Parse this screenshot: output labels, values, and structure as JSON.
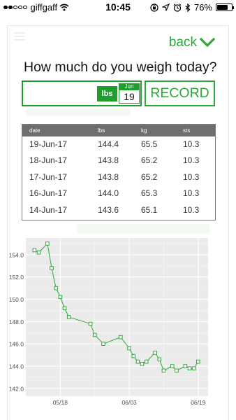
{
  "status_bar": {
    "carrier": "giffgaff",
    "time": "10:45",
    "battery": "76%",
    "battery_level": 0.76
  },
  "header": {
    "back_label": "back"
  },
  "form": {
    "question": "How much do you weigh today?",
    "weight_value": "",
    "unit_label": "lbs",
    "date_month": "Jun",
    "date_day": "19",
    "record_label": "RECORD"
  },
  "table": {
    "headers": [
      "date",
      "lbs",
      "kg",
      "sts"
    ],
    "rows": [
      [
        "19-Jun-17",
        "144.4",
        "65.5",
        "10.3"
      ],
      [
        "18-Jun-17",
        "143.8",
        "65.2",
        "10.3"
      ],
      [
        "17-Jun-17",
        "143.8",
        "65.2",
        "10.3"
      ],
      [
        "16-Jun-17",
        "144.0",
        "65.3",
        "10.3"
      ],
      [
        "14-Jun-17",
        "143.6",
        "65.1",
        "10.3"
      ]
    ]
  },
  "colors": {
    "accent": "#2ea73a",
    "accent_dark": "#1e9e2c",
    "table_header": "#6e6e6e",
    "chart_bg": "#ebebeb"
  },
  "chart_data": {
    "type": "line",
    "title": "",
    "xlabel": "",
    "ylabel": "",
    "ylim": [
      141.3,
      155.5
    ],
    "y_ticks": [
      "142.0",
      "144.0",
      "146.0",
      "148.0",
      "150.0",
      "152.0",
      "154.0"
    ],
    "x_ticks": [
      "05/18",
      "06/03",
      "06/19"
    ],
    "grid": true,
    "series": [
      {
        "dates": [
          "05/12",
          "05/13",
          "05/15",
          "05/16",
          "05/17",
          "05/18",
          "05/19",
          "05/20",
          "05/25",
          "05/26",
          "05/28",
          "06/01",
          "06/03",
          "06/04",
          "06/05",
          "06/06",
          "06/07",
          "06/09",
          "06/10",
          "06/11",
          "06/13",
          "06/14",
          "06/16",
          "06/17",
          "06/18",
          "06/19"
        ],
        "values": [
          154.4,
          154.2,
          155.0,
          152.8,
          151.0,
          150.2,
          149.2,
          148.4,
          147.8,
          146.8,
          146.0,
          146.6,
          145.6,
          144.9,
          144.4,
          144.2,
          144.4,
          145.2,
          144.6,
          143.6,
          144.0,
          143.6,
          144.0,
          143.8,
          143.8,
          144.4
        ]
      }
    ]
  }
}
